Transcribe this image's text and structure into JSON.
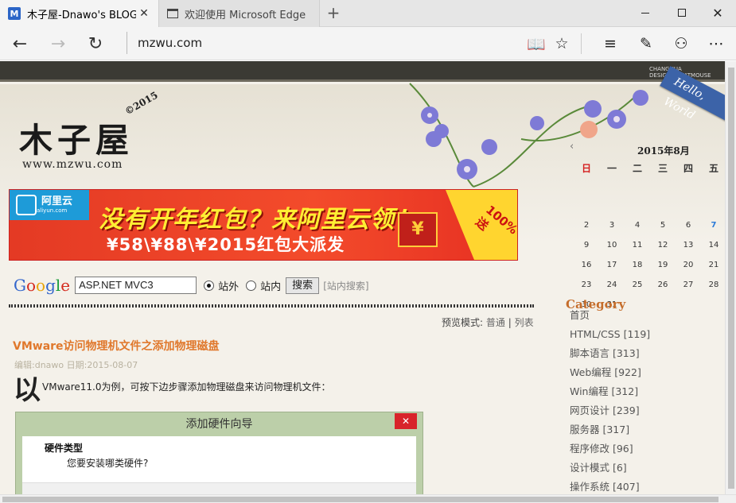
{
  "browser": {
    "tabs": [
      {
        "favicon": "M",
        "title": "木子屋-Dnawo's BLOG",
        "close": "✕"
      },
      {
        "title": "欢迎使用 Microsoft Edge"
      }
    ],
    "new_tab": "+",
    "address": "mzwu.com",
    "icons": {
      "back": "←",
      "forward": "→",
      "refresh": "↻",
      "reading_view": "📖",
      "favorite": "☆",
      "hub": "≡",
      "web_note": "✎",
      "share": "⚇",
      "more": "⋯",
      "minimize": "minimize-icon",
      "maximize": "maximize-icon",
      "close": "✕"
    }
  },
  "header": {
    "logo_text": "木子屋",
    "logo_year": "©2015",
    "logo_url": "www.mzwu.com",
    "ribbon_text": "Hello, World",
    "badge_line1": "CHANGHUA",
    "badge_line2": "DESIGN BY FATMOUSE"
  },
  "banner": {
    "brand": "阿里云",
    "brand_sub": "aliyun.com",
    "headline": "没有开年红包？来阿里云领！",
    "subline": "¥58\\¥88\\¥2015红包大派发",
    "envelope": "¥",
    "corner": "100%送"
  },
  "search": {
    "google_letters": [
      "G",
      "o",
      "o",
      "g",
      "l",
      "e"
    ],
    "query": "ASP.NET MVC3",
    "option_external": "站外",
    "option_internal": "站内",
    "button": "搜索",
    "site_search_link": "[站内搜索]"
  },
  "view_mode": {
    "label": "预览模式:",
    "normal": "普通",
    "sep": "|",
    "list": "列表"
  },
  "post": {
    "title": "VMware访问物理机文件之添加物理磁盘",
    "meta": "编辑:dnawo  日期:2015-08-07",
    "dropcap": "以",
    "intro": "VMware11.0为例，可按下边步骤添加物理磁盘来访问物理机文件：",
    "dialog": {
      "title": "添加硬件向导",
      "close": "✕",
      "heading": "硬件类型",
      "question": "您要安装哪类硬件?"
    }
  },
  "calendar": {
    "prev": "‹",
    "title": "2015年8月",
    "weekdays": [
      "日",
      "一",
      "二",
      "三",
      "四",
      "五"
    ],
    "days": [
      "",
      "",
      "",
      "",
      "",
      "",
      "2",
      "3",
      "4",
      "5",
      "6",
      "7",
      "9",
      "10",
      "11",
      "12",
      "13",
      "14",
      "16",
      "17",
      "18",
      "19",
      "20",
      "21",
      "23",
      "24",
      "25",
      "26",
      "27",
      "28",
      "30",
      "31",
      "",
      "",
      "",
      ""
    ],
    "today": "7"
  },
  "category": {
    "title": "Category",
    "items": [
      "首页",
      "HTML/CSS [119]",
      "脚本语言 [313]",
      "Web编程 [922]",
      "Win编程 [312]",
      "网页设计 [239]",
      "服务器 [317]",
      "程序修改 [96]",
      "设计模式 [6]",
      "操作系统 [407]"
    ]
  }
}
